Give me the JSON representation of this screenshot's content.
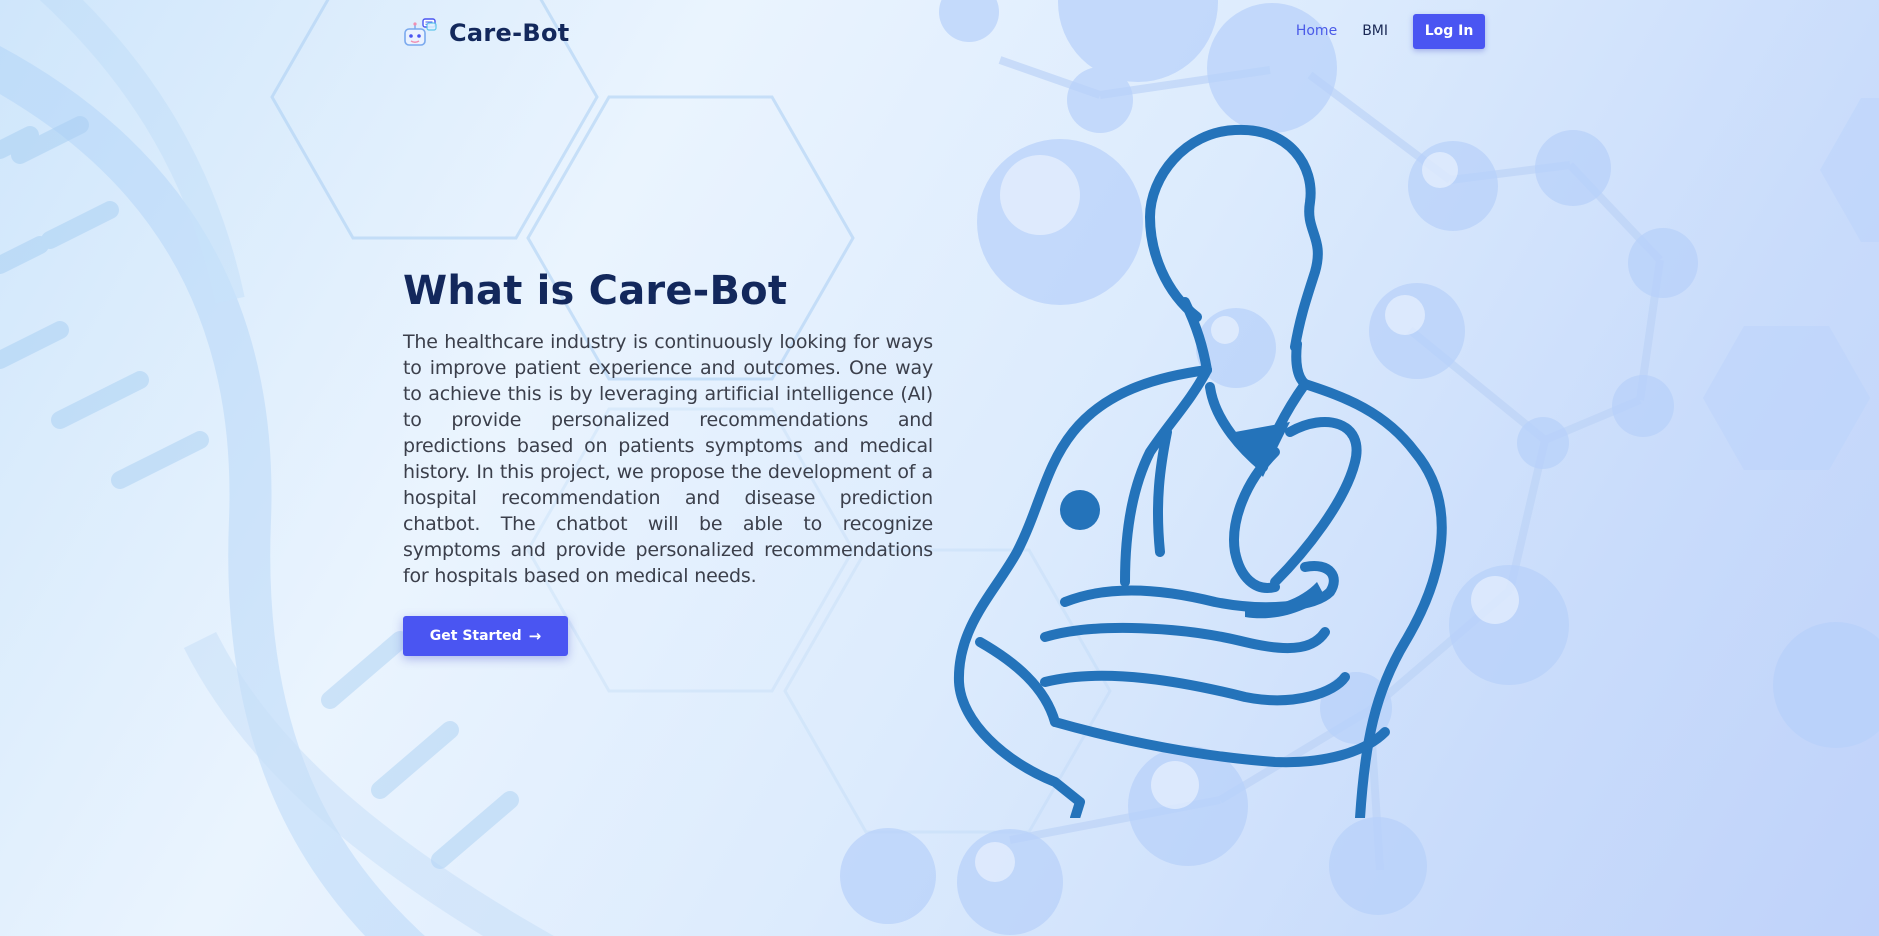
{
  "brand": {
    "name": "Care-Bot"
  },
  "nav": {
    "items": [
      {
        "label": "Home",
        "active": true
      },
      {
        "label": "BMI",
        "active": false
      }
    ],
    "login_label": "Log In"
  },
  "hero": {
    "title": "What is Care-Bot",
    "description": "The healthcare industry is continuously looking for ways to improve patient experience and outcomes. One way to achieve this is by leveraging artificial intelligence (AI) to provide personalized recommendations and predictions based on patients symptoms and medical history. In this project, we propose the development of a hospital recommendation and disease prediction chatbot. The chatbot will be able to recognize symptoms and provide personalized recommendations for hospitals based on medical needs.",
    "cta_label": "Get Started",
    "cta_icon": "arrow-right-icon"
  },
  "icons": {
    "logo": "robot-chat-icon",
    "illustration": "doctor-illustration"
  },
  "colors": {
    "primary": "#4a55f2",
    "heading": "#13285c",
    "body_text": "#3b3f4b",
    "nav_active": "#4a5ae8",
    "illustration": "#2473ba"
  }
}
